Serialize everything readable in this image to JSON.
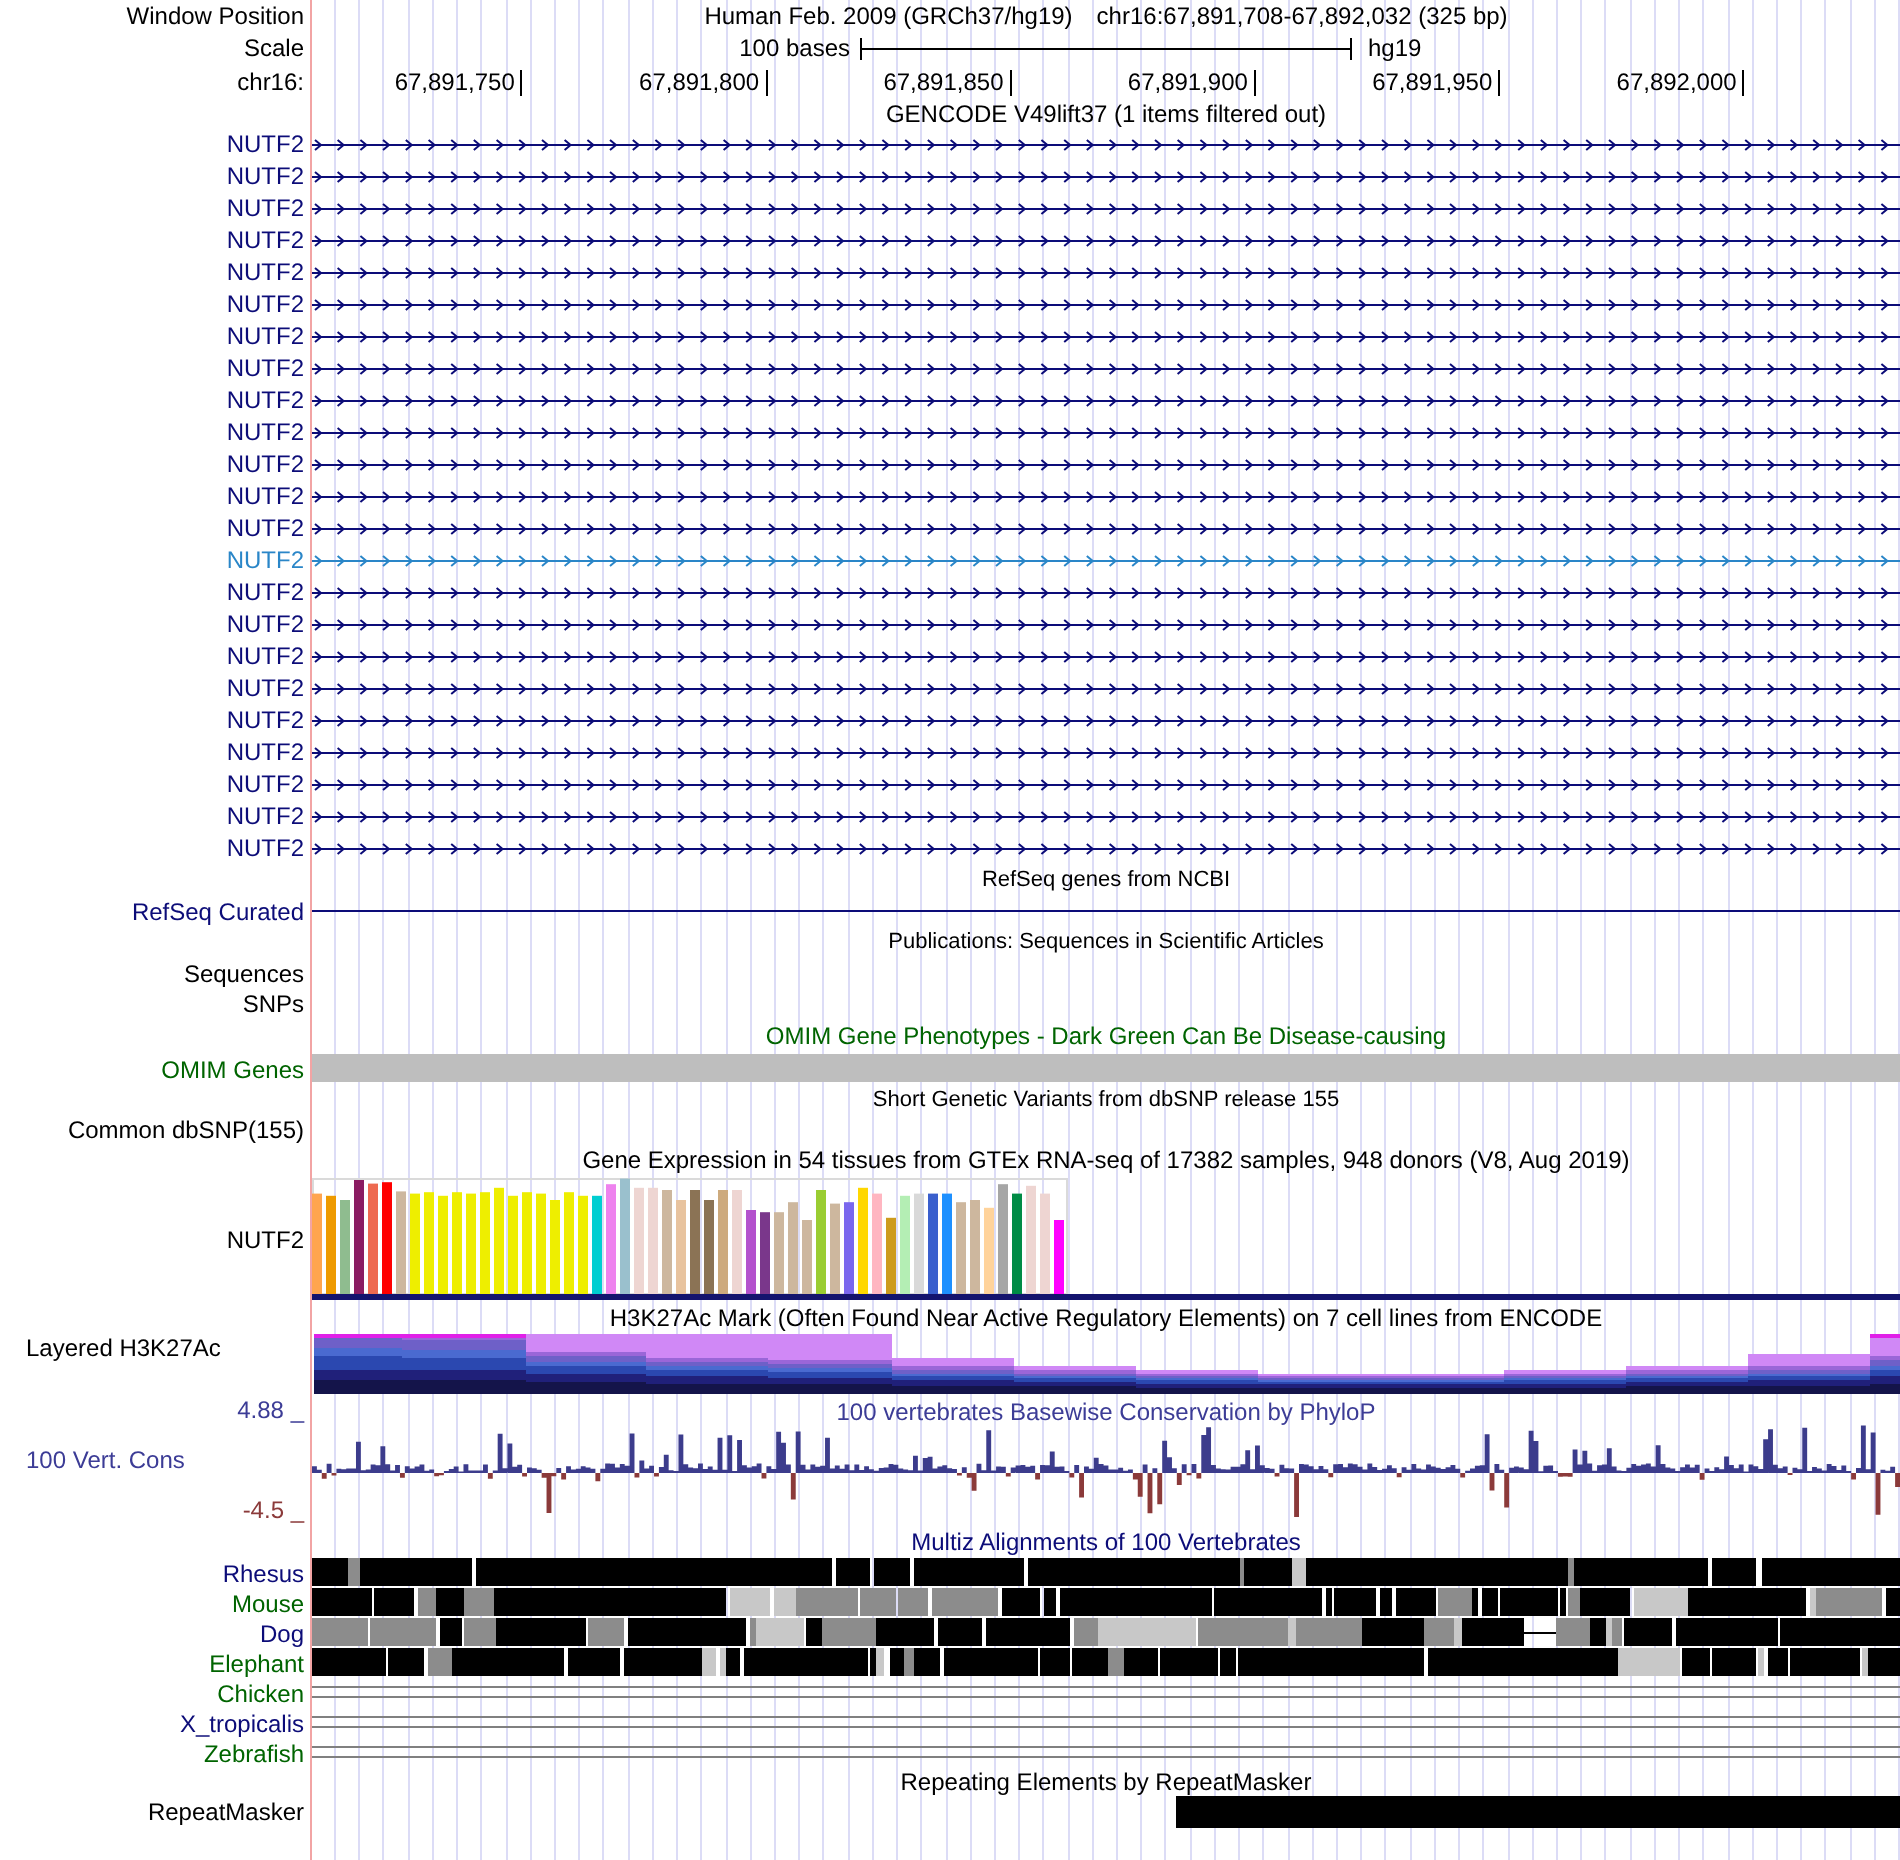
{
  "header": {
    "position_label": "Window Position",
    "assembly": "Human Feb. 2009 (GRCh37/hg19)",
    "position": "chr16:67,891,708-67,892,032 (325 bp)",
    "scale_label": "Scale",
    "scale_text": "100 bases",
    "scale_db": "hg19",
    "chrom_label": "chr16:",
    "ticks": [
      "67,891,750",
      "67,891,800",
      "67,891,850",
      "67,891,900",
      "67,891,950",
      "67,892,000"
    ]
  },
  "tracks": [
    {
      "kind": "gencode",
      "title": "GENCODE V49lift37 (1 items filtered out)",
      "items": [
        {
          "label": "NUTF2",
          "highlighted": false
        },
        {
          "label": "NUTF2",
          "highlighted": false
        },
        {
          "label": "NUTF2",
          "highlighted": false
        },
        {
          "label": "NUTF2",
          "highlighted": false
        },
        {
          "label": "NUTF2",
          "highlighted": false
        },
        {
          "label": "NUTF2",
          "highlighted": false
        },
        {
          "label": "NUTF2",
          "highlighted": false
        },
        {
          "label": "NUTF2",
          "highlighted": false
        },
        {
          "label": "NUTF2",
          "highlighted": false
        },
        {
          "label": "NUTF2",
          "highlighted": false
        },
        {
          "label": "NUTF2",
          "highlighted": false
        },
        {
          "label": "NUTF2",
          "highlighted": false
        },
        {
          "label": "NUTF2",
          "highlighted": false
        },
        {
          "label": "NUTF2",
          "highlighted": true
        },
        {
          "label": "NUTF2",
          "highlighted": false
        },
        {
          "label": "NUTF2",
          "highlighted": false
        },
        {
          "label": "NUTF2",
          "highlighted": false
        },
        {
          "label": "NUTF2",
          "highlighted": false
        },
        {
          "label": "NUTF2",
          "highlighted": false
        },
        {
          "label": "NUTF2",
          "highlighted": false
        },
        {
          "label": "NUTF2",
          "highlighted": false
        },
        {
          "label": "NUTF2",
          "highlighted": false
        },
        {
          "label": "NUTF2",
          "highlighted": false
        }
      ]
    },
    {
      "kind": "refseq",
      "title": "RefSeq genes from NCBI",
      "label": "RefSeq Curated"
    },
    {
      "kind": "publications",
      "title": "Publications: Sequences in Scientific Articles",
      "labels": [
        "Sequences",
        "SNPs"
      ]
    },
    {
      "kind": "omim",
      "title": "OMIM Gene Phenotypes - Dark Green Can Be Disease-causing",
      "label": "OMIM Genes"
    },
    {
      "kind": "dbsnp",
      "title": "Short Genetic Variants from dbSNP release 155",
      "label": "Common dbSNP(155)"
    },
    {
      "kind": "gtex",
      "title": "Gene Expression in 54 tissues from GTEx RNA-seq of 17382 samples, 948 donors (V8, Aug 2019)",
      "label": "NUTF2"
    },
    {
      "kind": "h3k27ac",
      "title": "H3K27Ac Mark (Often Found Near Active Regulatory Elements) on 7 cell lines from ENCODE",
      "label": "Layered H3K27Ac"
    },
    {
      "kind": "phylop",
      "title": "100 vertebrates Basewise Conservation by PhyloP",
      "label": "100 Vert. Cons",
      "max_label": "4.88 _",
      "min_label": "-4.5 _"
    },
    {
      "kind": "multiz",
      "title": "Multiz Alignments of 100 Vertebrates",
      "species": [
        {
          "name": "Rhesus",
          "color": "#0c0c78",
          "kind": "blocks"
        },
        {
          "name": "Mouse",
          "color": "#006400",
          "kind": "blocks"
        },
        {
          "name": "Dog",
          "color": "#0c0c78",
          "kind": "blocks"
        },
        {
          "name": "Elephant",
          "color": "#006400",
          "kind": "blocks"
        },
        {
          "name": "Chicken",
          "color": "#006400",
          "kind": "lines"
        },
        {
          "name": "X_tropicalis",
          "color": "#0c0c78",
          "kind": "lines"
        },
        {
          "name": "Zebrafish",
          "color": "#006400",
          "kind": "lines"
        }
      ]
    },
    {
      "kind": "repeatmasker",
      "title": "Repeating Elements by RepeatMasker",
      "label": "RepeatMasker"
    }
  ]
}
